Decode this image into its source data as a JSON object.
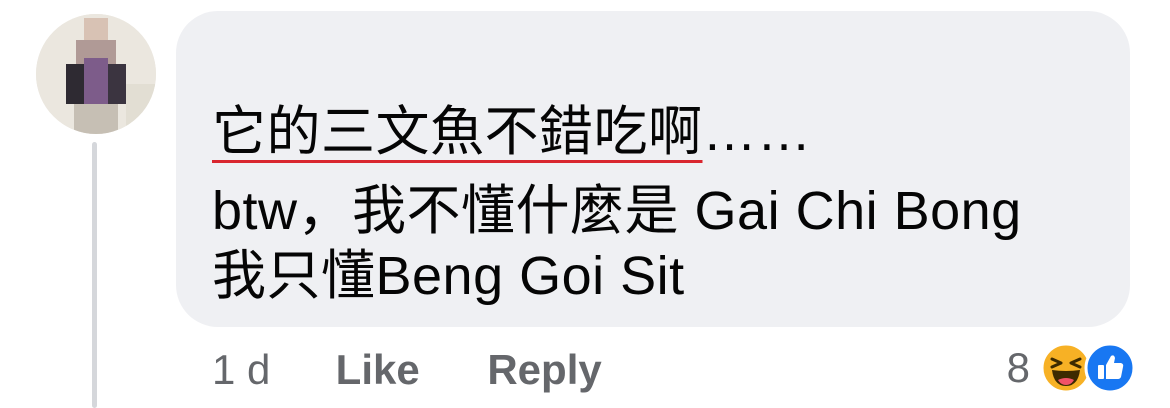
{
  "comment": {
    "author_name": "",
    "text_lines": [
      {
        "underlined": "它的三文魚不錯吃啊",
        "rest": "……"
      },
      {
        "text": "btw，我不懂什麼是 Gai Chi Bong"
      },
      {
        "text": "我只懂Beng Goi Sit"
      }
    ],
    "underline_color": "#d9262f"
  },
  "actions": {
    "timestamp": "1 d",
    "like_label": "Like",
    "reply_label": "Reply"
  },
  "reactions": {
    "count": "8",
    "icons": [
      "laughing-emoji-icon",
      "thumbs-up-icon"
    ],
    "like_color": "#1877f2",
    "haha_color": "#f7b125"
  },
  "colors": {
    "bubble": "#eff0f3",
    "text": "#050505",
    "secondary": "#65676b"
  }
}
